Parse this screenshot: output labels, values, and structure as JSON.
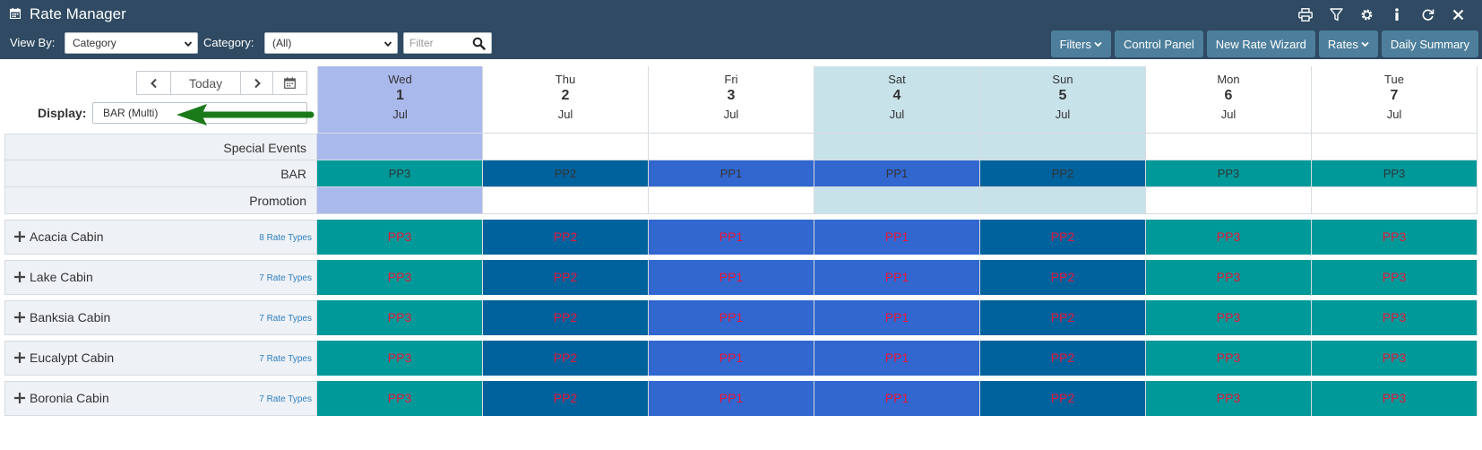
{
  "app": {
    "title": "Rate Manager"
  },
  "toolbar": {
    "view_by_label": "View By:",
    "view_by_value": "Category",
    "category_label": "Category:",
    "category_value": "(All)",
    "filter_placeholder": "Filter",
    "buttons": {
      "filters": "Filters",
      "control_panel": "Control Panel",
      "new_rate_wizard": "New Rate Wizard",
      "rates": "Rates",
      "daily_summary": "Daily Summary"
    }
  },
  "nav": {
    "today_label": "Today",
    "display_label": "Display:",
    "display_value": "BAR (Multi)"
  },
  "days": [
    {
      "name": "Wed",
      "date": "1",
      "month": "Jul"
    },
    {
      "name": "Thu",
      "date": "2",
      "month": "Jul"
    },
    {
      "name": "Fri",
      "date": "3",
      "month": "Jul"
    },
    {
      "name": "Sat",
      "date": "4",
      "month": "Jul"
    },
    {
      "name": "Sun",
      "date": "5",
      "month": "Jul"
    },
    {
      "name": "Mon",
      "date": "6",
      "month": "Jul"
    },
    {
      "name": "Tue",
      "date": "7",
      "month": "Jul"
    }
  ],
  "summary_rows": {
    "special_events_label": "Special Events",
    "bar_label": "BAR",
    "promotion_label": "Promotion"
  },
  "bar_values": [
    "PP3",
    "PP2",
    "PP1",
    "PP1",
    "PP2",
    "PP3",
    "PP3"
  ],
  "rooms": [
    {
      "name": "Acacia Cabin",
      "rate_types": "8 Rate Types",
      "rates": [
        "PP3",
        "PP2",
        "PP1",
        "PP1",
        "PP2",
        "PP3",
        "PP3"
      ]
    },
    {
      "name": "Lake Cabin",
      "rate_types": "7 Rate Types",
      "rates": [
        "PP3",
        "PP2",
        "PP1",
        "PP1",
        "PP2",
        "PP3",
        "PP3"
      ]
    },
    {
      "name": "Banksia Cabin",
      "rate_types": "7 Rate Types",
      "rates": [
        "PP3",
        "PP2",
        "PP1",
        "PP1",
        "PP2",
        "PP3",
        "PP3"
      ]
    },
    {
      "name": "Eucalypt Cabin",
      "rate_types": "7 Rate Types",
      "rates": [
        "PP3",
        "PP2",
        "PP1",
        "PP1",
        "PP2",
        "PP3",
        "PP3"
      ]
    },
    {
      "name": "Boronia Cabin",
      "rate_types": "7 Rate Types",
      "rates": [
        "PP3",
        "PP2",
        "PP1",
        "PP1",
        "PP2",
        "PP3",
        "PP3"
      ]
    }
  ],
  "colors": {
    "header_bg": "#2f4a62",
    "button_bg": "#4d7f9c",
    "today_col": "#aab9ec",
    "weekend_col": "#c8e2ea",
    "pp1": "#3167cf",
    "pp2": "#00629c",
    "pp3": "#00999a",
    "rate_text": "#e8163a",
    "arrow": "#1a7a1a"
  }
}
